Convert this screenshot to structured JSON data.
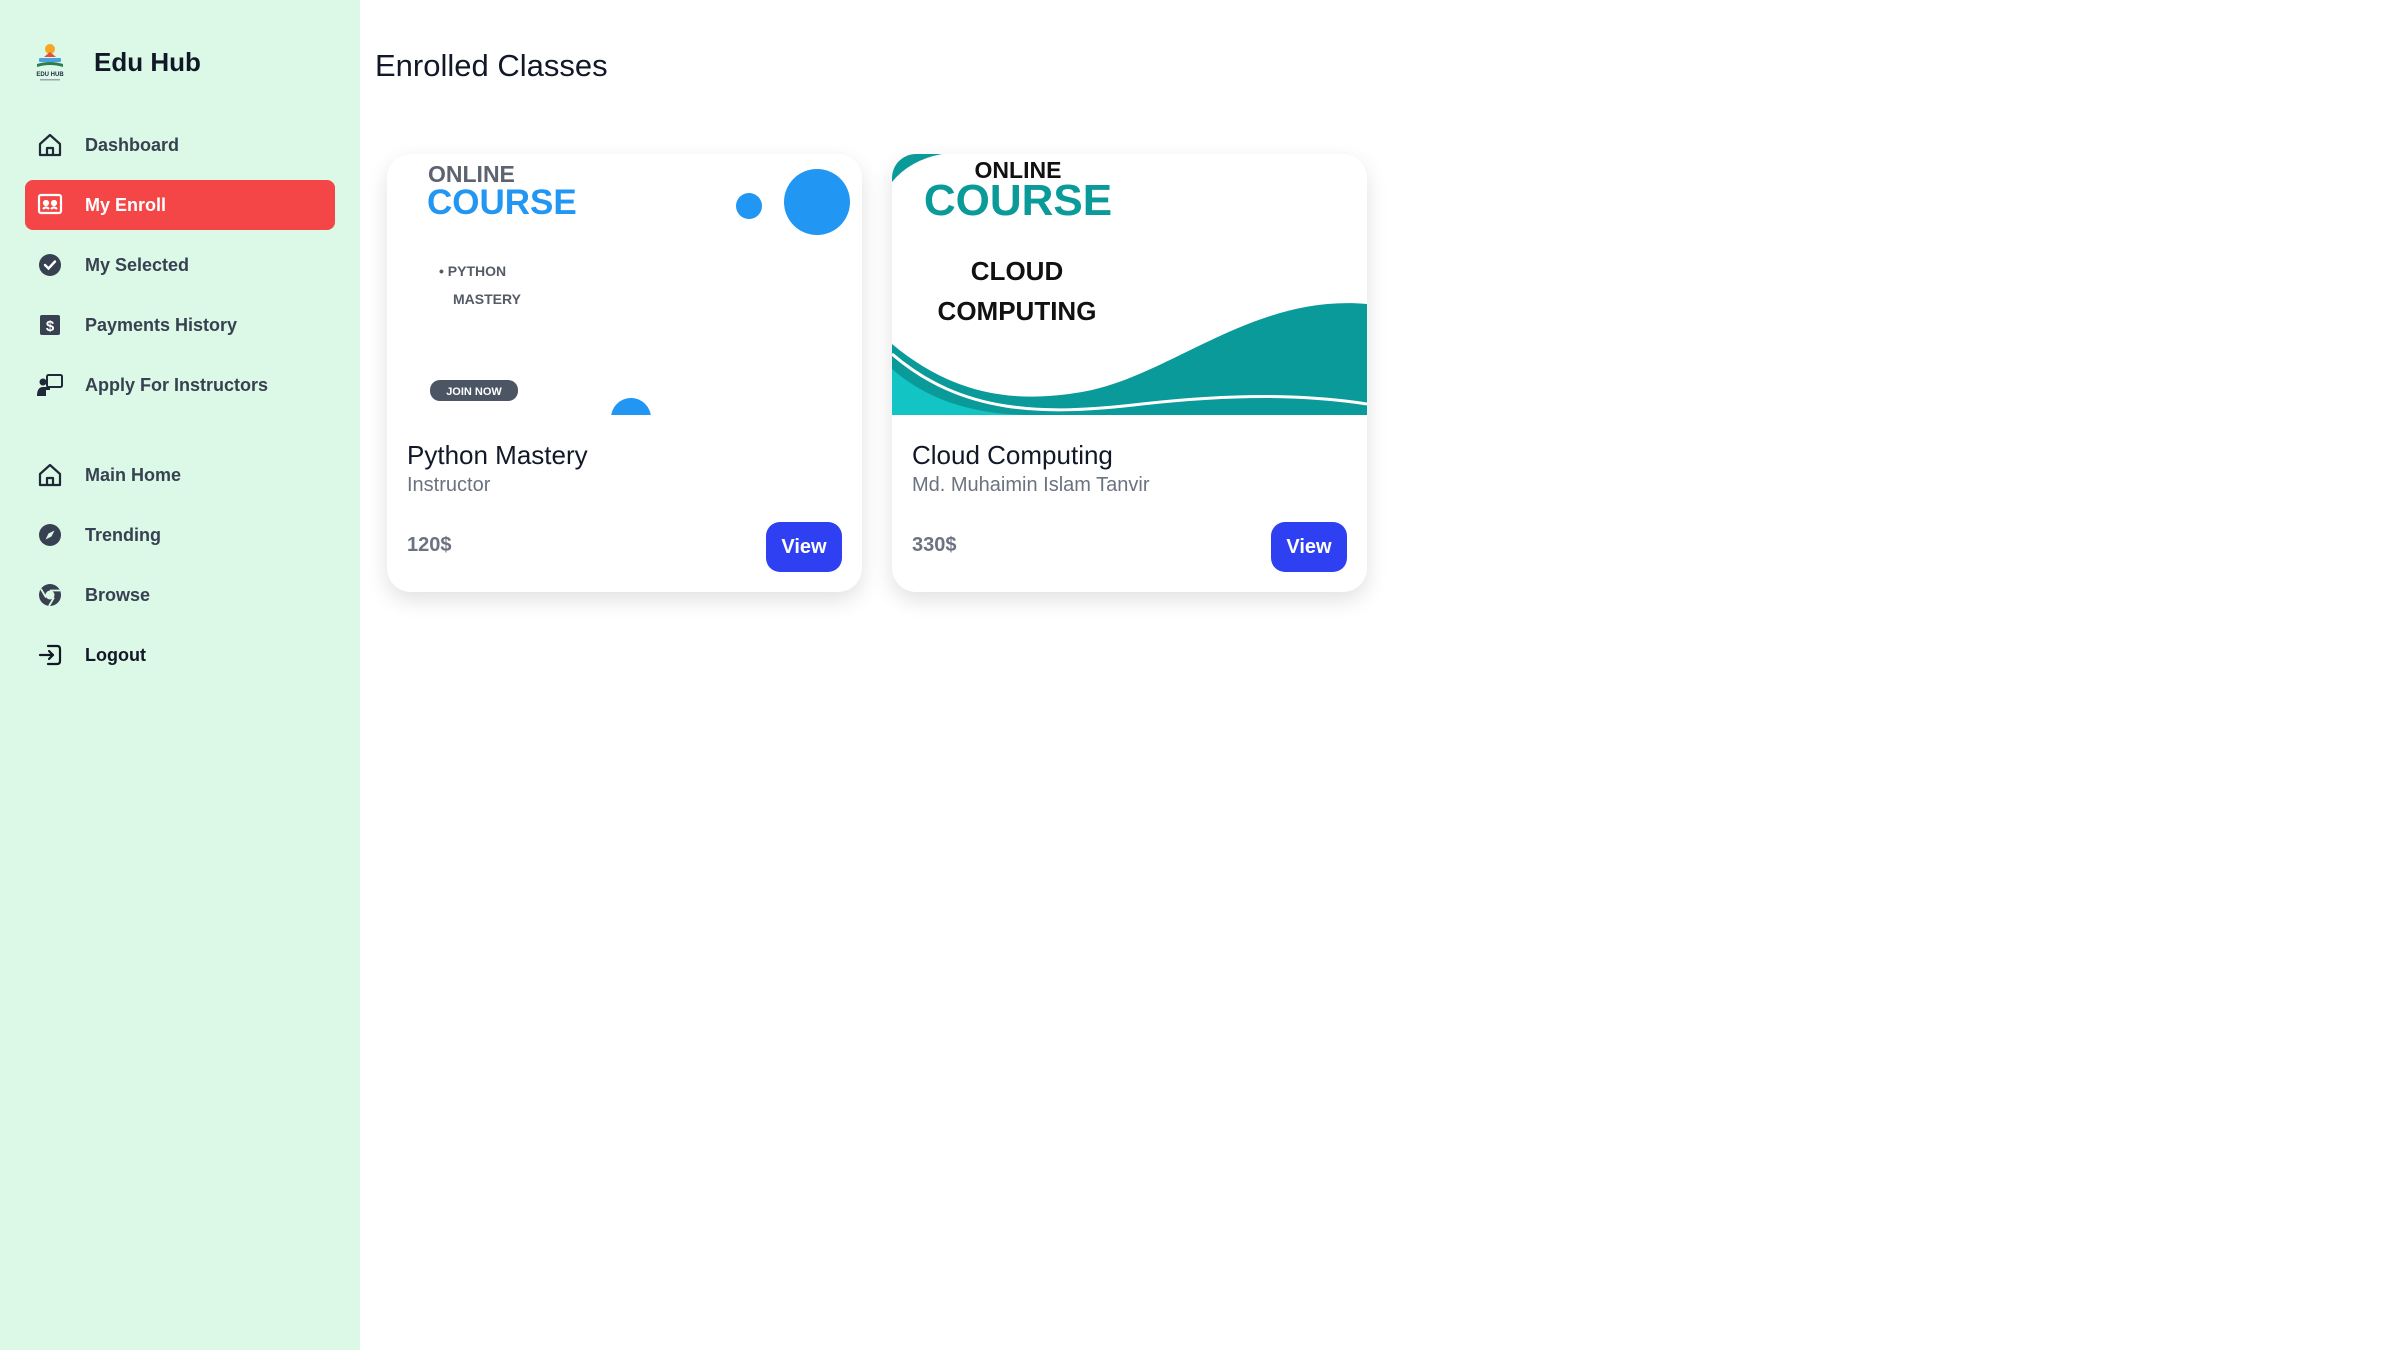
{
  "brand": {
    "name": "Edu Hub",
    "logo_text": "EDU HUB"
  },
  "nav": {
    "primary": [
      {
        "label": "Dashboard",
        "icon": "home-icon",
        "active": false
      },
      {
        "label": "My Enroll",
        "icon": "enroll-icon",
        "active": true
      },
      {
        "label": "My Selected",
        "icon": "check-circle-icon",
        "active": false
      },
      {
        "label": "Payments History",
        "icon": "dollar-icon",
        "active": false
      },
      {
        "label": "Apply For Instructors",
        "icon": "presenter-icon",
        "active": false
      }
    ],
    "secondary": [
      {
        "label": "Main Home",
        "icon": "home-icon"
      },
      {
        "label": "Trending",
        "icon": "compass-icon"
      },
      {
        "label": "Browse",
        "icon": "chrome-icon"
      },
      {
        "label": "Logout",
        "icon": "logout-icon"
      }
    ]
  },
  "page": {
    "title": "Enrolled Classes"
  },
  "courses": [
    {
      "title": "Python Mastery",
      "instructor": "Instructor",
      "price": "120$",
      "view_label": "View",
      "thumbnail": {
        "line1": "ONLINE",
        "line2": "COURSE",
        "bullet1": "• PYTHON",
        "bullet2": "MASTERY",
        "badge": "JOIN NOW",
        "accent": "#2196f3"
      }
    },
    {
      "title": "Cloud Computing",
      "instructor": "Md. Muhaimin Islam Tanvir",
      "price": "330$",
      "view_label": "View",
      "thumbnail": {
        "line1": "ONLINE",
        "line2": "COURSE",
        "sub1": "CLOUD",
        "sub2": "COMPUTING",
        "accent": "#0a9a9a"
      }
    }
  ],
  "colors": {
    "sidebar_bg": "#dcf8e6",
    "active_nav": "#f44646",
    "button": "#2e40f2"
  }
}
